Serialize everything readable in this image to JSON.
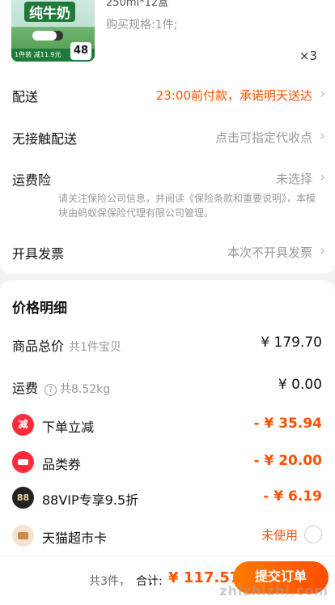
{
  "product": {
    "logo_text": "纯牛奶",
    "badge_text": "1件装 减11.9元",
    "price_badge": "48",
    "spec_head": "250ml*12盒",
    "spec": "购买规格:1件;",
    "quantity": "×3"
  },
  "delivery": {
    "label": "配送",
    "value": "23:00前付款，承诺明天送达"
  },
  "contactless": {
    "label": "无接触配送",
    "value": "点击可指定代收点"
  },
  "insurance": {
    "label": "运费险",
    "value": "未选择",
    "note": "请关注保险公司信息，并阅读《保险条款和重要说明》，本模块由蚂蚁保保险代理有限公司管理。"
  },
  "invoice": {
    "label": "开具发票",
    "value": "本次不开具发票"
  },
  "price_detail": {
    "title": "价格明细",
    "items_total": {
      "label": "商品总价",
      "sub": "共1件宝贝",
      "amount": "¥ 179.70"
    },
    "shipping": {
      "label": "运费",
      "sub": "共8.52kg",
      "amount": "¥ 0.00"
    },
    "instant_discount": {
      "label": "下单立减",
      "icon_text": "减",
      "amount": "- ¥ 35.94"
    },
    "category_coupon": {
      "label": "品类券",
      "amount": "- ¥ 20.00"
    },
    "vip": {
      "label": "88VIP专享9.5折",
      "icon_text": "88",
      "amount": "- ¥ 6.19"
    },
    "tmall_card": {
      "label": "天猫超市卡",
      "status": "未使用"
    }
  },
  "footer": {
    "count": "共3件，",
    "total_label": "合计:",
    "total": "¥ 117.57",
    "submit_label": "提交订单"
  },
  "watermark": "zhizhizhi.com"
}
